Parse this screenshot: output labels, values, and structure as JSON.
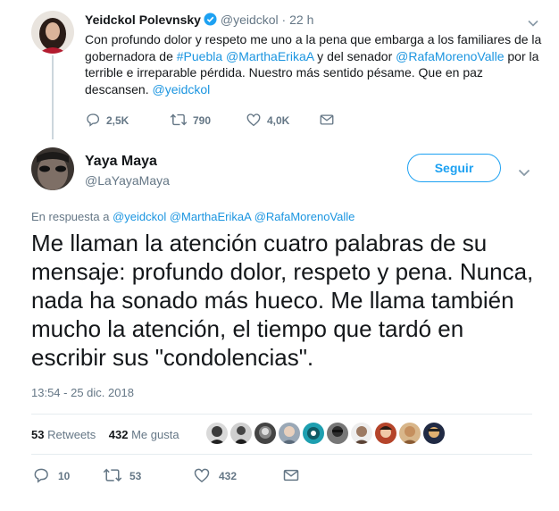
{
  "parent_tweet": {
    "name": "Yeidckol Polevnsky",
    "handle": "@yeidckol",
    "dot": "·",
    "time": "22 h",
    "text_parts": [
      {
        "t": "Con profundo dolor y respeto me uno a la pena que embarga a los familiares de la gobernadora de ",
        "link": false
      },
      {
        "t": "#Puebla",
        "link": true
      },
      {
        "t": " ",
        "link": false
      },
      {
        "t": "@MarthaErikaA",
        "link": true
      },
      {
        "t": " y del senador ",
        "link": false
      },
      {
        "t": "@RafaMorenoValle",
        "link": true
      },
      {
        "t": " por la terrible e irreparable pérdida. Nuestro más sentido pésame. Que en paz descansen. ",
        "link": false
      },
      {
        "t": "@yeidckol",
        "link": true
      }
    ],
    "replies": "2,5K",
    "retweets": "790",
    "likes": "4,0K"
  },
  "main_tweet": {
    "name": "Yaya Maya",
    "handle": "@LaYayaMaya",
    "follow_label": "Seguir",
    "reply_prefix": "En respuesta a",
    "reply_mentions": "@yeidckol @MarthaErikaA @RafaMorenoValle",
    "text": "Me llaman la atención cuatro palabras de su mensaje: profundo dolor, respeto y pena. Nunca, nada ha sonado más hueco. Me llama también mucho la atención, el tiempo que tardó en escribir sus \"condolencias\".",
    "timestamp": "13:54 - 25 dic. 2018",
    "retweets_count": "53",
    "retweets_label": "Retweets",
    "likes_count": "432",
    "likes_label": "Me gusta",
    "replies": "10",
    "retweets": "53",
    "likes": "432"
  },
  "colors": {
    "link": "#1b95e0",
    "follow": "#1da1f2",
    "muted": "#657786",
    "verified": "#1da1f2"
  }
}
